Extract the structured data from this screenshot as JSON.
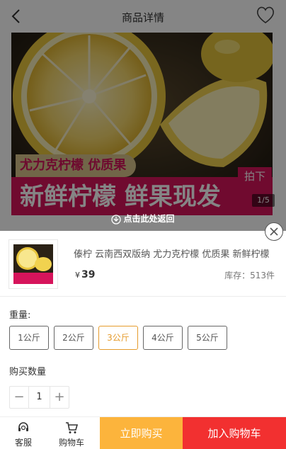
{
  "header": {
    "title": "商品详情",
    "back_icon": "chevron-left-icon",
    "fav_icon": "heart-outline-icon"
  },
  "banner": {
    "slogan_small": "尤力克柠檬 优质果",
    "slogan_big": "新鲜柠檬 鲜果现发",
    "taste_badge": "拍下",
    "counter": "1/5",
    "return_label": "点击此处返回"
  },
  "product": {
    "name": "傣柠 云南西双版纳 尤力克柠檬 优质果 新鲜柠檬 鲜果现发",
    "currency": "¥",
    "price": "39",
    "stock": "库存：513件"
  },
  "spec": {
    "label": "重量:",
    "options": [
      "1公斤",
      "2公斤",
      "3公斤",
      "4公斤",
      "5公斤"
    ],
    "selected": "3公斤"
  },
  "quantity": {
    "label": "购买数量",
    "minus": "−",
    "value": "1",
    "plus": "+"
  },
  "bottom": {
    "service_label": "客服",
    "cart_label": "购物车",
    "buy_now": "立即购买",
    "add_to_cart": "加入购物车"
  },
  "colors": {
    "accent_orange": "#fcb43c",
    "accent_red": "#f23030",
    "selected_option": "#e59b2c",
    "banner_pink": "#d6145b"
  }
}
